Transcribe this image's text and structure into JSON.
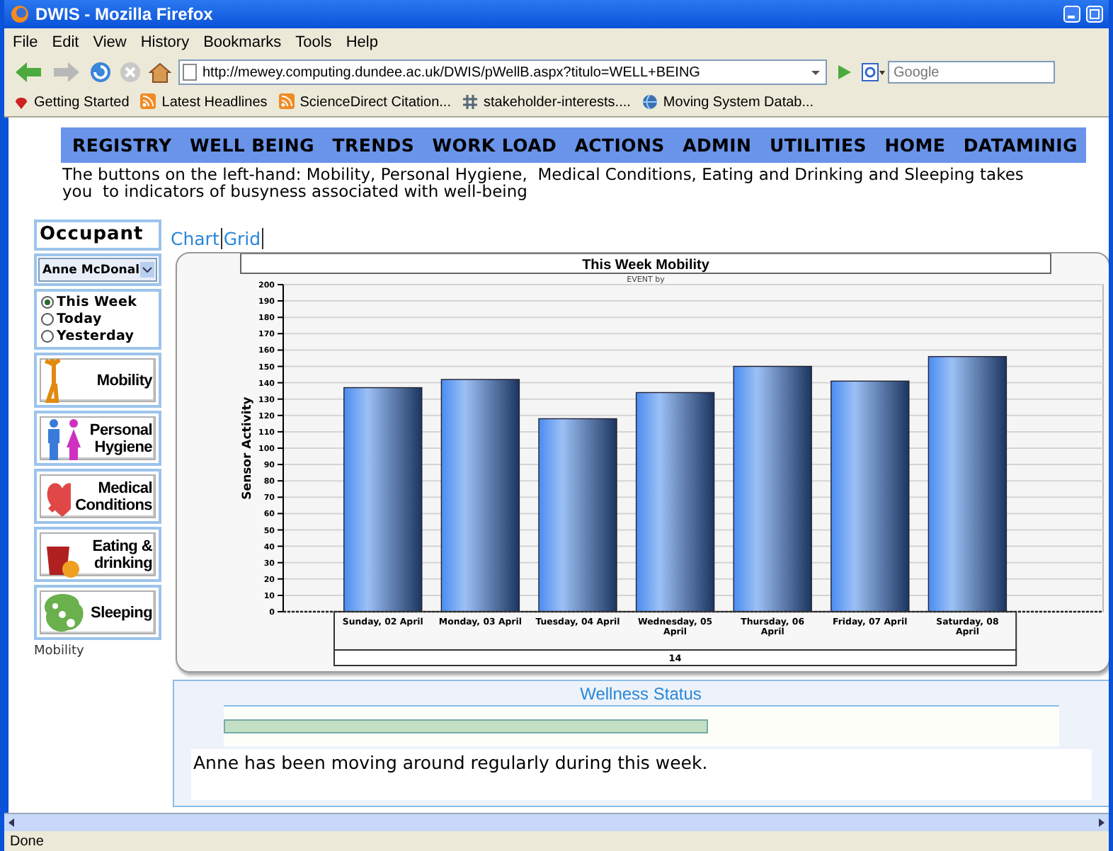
{
  "window": {
    "title": "DWIS - Mozilla Firefox"
  },
  "menu": [
    "File",
    "Edit",
    "View",
    "History",
    "Bookmarks",
    "Tools",
    "Help"
  ],
  "address": {
    "value": "http://mewey.computing.dundee.ac.uk/DWIS/pWellB.aspx?titulo=WELL+BEING"
  },
  "search": {
    "placeholder": "Google"
  },
  "bookmarks": [
    {
      "label": "Getting Started",
      "kind": "page"
    },
    {
      "label": "Latest Headlines",
      "kind": "feed"
    },
    {
      "label": "ScienceDirect Citation...",
      "kind": "feed"
    },
    {
      "label": "stakeholder-interests....",
      "kind": "hash"
    },
    {
      "label": "Moving System Datab...",
      "kind": "globe"
    }
  ],
  "nav": [
    "REGISTRY",
    "WELL BEING",
    "TRENDS",
    "WORK LOAD",
    "ACTIONS",
    "ADMIN",
    "UTILITIES",
    "HOME",
    "DATAMINIG"
  ],
  "intro": "The buttons on the left-hand: Mobility, Personal Hygiene,  Medical Conditions, Eating and Drinking and Sleeping takes you  to indicators of busyness associated with well-being",
  "sidebar": {
    "heading": "Occupant",
    "occupant": "Anne McDonal",
    "periods": [
      {
        "label": "This Week",
        "selected": true
      },
      {
        "label": "Today",
        "selected": false
      },
      {
        "label": "Yesterday",
        "selected": false
      }
    ],
    "buttons": [
      {
        "label": "Mobility",
        "kind": "mobility"
      },
      {
        "label": "Personal Hygiene",
        "kind": "hygiene"
      },
      {
        "label": "Medical Conditions",
        "kind": "medical"
      },
      {
        "label": "Eating & drinking",
        "kind": "eating"
      },
      {
        "label": "Sleeping",
        "kind": "sleeping"
      }
    ],
    "caption": "Mobility"
  },
  "view_tabs": [
    "Chart",
    "Grid"
  ],
  "chart": {
    "subtitle": "EVENT by",
    "footer": "14",
    "chart_data": {
      "type": "bar",
      "title": "This Week Mobility",
      "ylabel": "Sensor Activity",
      "categories": [
        "Sunday, 02 April",
        "Monday, 03 April",
        "Tuesday, 04 April",
        "Wednesday, 05 April",
        "Thursday, 06 April",
        "Friday, 07 April",
        "Saturday, 08 April"
      ],
      "values": [
        137,
        142,
        118,
        134,
        150,
        141,
        156
      ],
      "ylim": [
        0,
        200
      ],
      "grid": true,
      "yticks": [
        0,
        10,
        20,
        30,
        40,
        50,
        60,
        70,
        80,
        90,
        100,
        110,
        120,
        130,
        140,
        150,
        160,
        170,
        180,
        190,
        200
      ]
    }
  },
  "wellness": {
    "title": "Wellness Status",
    "level": 0.58,
    "message": "Anne has been moving around regularly during this week."
  },
  "status_bar": {
    "text": "Done"
  }
}
